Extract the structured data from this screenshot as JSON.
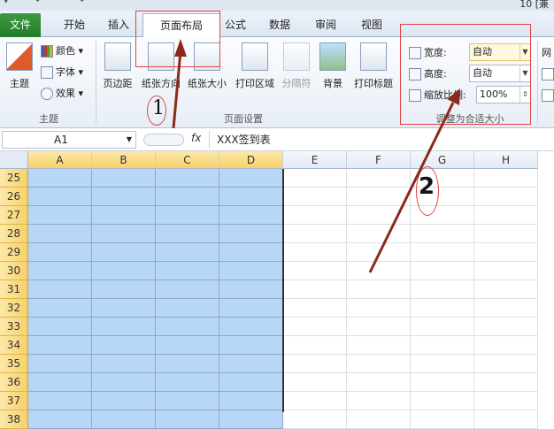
{
  "titlebar": {
    "right_text": "10 [兼"
  },
  "tabs": [
    {
      "label": "文件"
    },
    {
      "label": "开始"
    },
    {
      "label": "插入"
    },
    {
      "label": "页面布局"
    },
    {
      "label": "公式"
    },
    {
      "label": "数据"
    },
    {
      "label": "审阅"
    },
    {
      "label": "视图"
    }
  ],
  "ribbon": {
    "theme": {
      "main_label": "主题",
      "colors": "颜色",
      "fonts": "字体",
      "effects": "效果",
      "group_label": "主题"
    },
    "page_setup": {
      "buttons": [
        "页边距",
        "纸张方向",
        "纸张大小",
        "打印区域",
        "分隔符",
        "背景",
        "打印标题"
      ],
      "group_label": "页面设置"
    },
    "scale": {
      "width_label": "宽度:",
      "width_value": "自动",
      "height_label": "高度:",
      "height_value": "自动",
      "zoom_label": "缩放比例:",
      "zoom_value": "100%",
      "group_label": "调整为合适大小"
    },
    "sheet_opts_partial": "网"
  },
  "formula_bar": {
    "name_box": "A1",
    "fx": "fx",
    "content": "XXX签到表"
  },
  "sheet": {
    "columns": [
      "A",
      "B",
      "C",
      "D",
      "E",
      "F",
      "G",
      "H"
    ],
    "rows": [
      "25",
      "26",
      "27",
      "28",
      "29",
      "30",
      "31",
      "32",
      "33",
      "34",
      "35",
      "36",
      "37",
      "38"
    ]
  },
  "annotations": {
    "mark1": "1",
    "mark2": "2"
  },
  "colors": {
    "accent_selected": "#b8d6f8",
    "annotation_red": "#e14444",
    "file_tab": "#2e8b34"
  }
}
